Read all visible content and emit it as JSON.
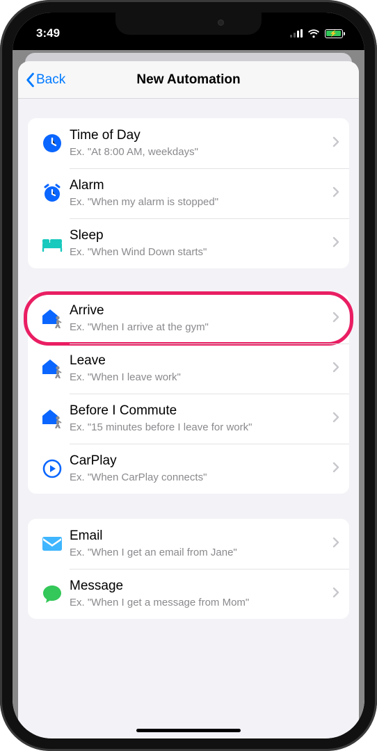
{
  "status": {
    "time": "3:49"
  },
  "nav": {
    "back_label": "Back",
    "title": "New Automation"
  },
  "groups": [
    {
      "rows": [
        {
          "icon": "clock-icon",
          "icon_color": "#0a66ff",
          "title": "Time of Day",
          "subtitle": "Ex. \"At 8:00 AM, weekdays\"",
          "highlight": false
        },
        {
          "icon": "alarm-icon",
          "icon_color": "#0a66ff",
          "title": "Alarm",
          "subtitle": "Ex. \"When my alarm is stopped\"",
          "highlight": false
        },
        {
          "icon": "bed-icon",
          "icon_color": "#18c9bd",
          "title": "Sleep",
          "subtitle": "Ex. \"When Wind Down starts\"",
          "highlight": false
        }
      ]
    },
    {
      "rows": [
        {
          "icon": "arrive-icon",
          "icon_color": "#0a66ff",
          "title": "Arrive",
          "subtitle": "Ex. \"When I arrive at the gym\"",
          "highlight": true
        },
        {
          "icon": "leave-icon",
          "icon_color": "#0a66ff",
          "title": "Leave",
          "subtitle": "Ex. \"When I leave work\"",
          "highlight": false
        },
        {
          "icon": "commute-icon",
          "icon_color": "#0a66ff",
          "title": "Before I Commute",
          "subtitle": "Ex. \"15 minutes before I leave for work\"",
          "highlight": false
        },
        {
          "icon": "carplay-icon",
          "icon_color": "#0a66ff",
          "title": "CarPlay",
          "subtitle": "Ex. \"When CarPlay connects\"",
          "highlight": false
        }
      ]
    },
    {
      "rows": [
        {
          "icon": "mail-icon",
          "icon_color": "#3fb6ff",
          "title": "Email",
          "subtitle": "Ex. \"When I get an email from Jane\"",
          "highlight": false
        },
        {
          "icon": "message-icon",
          "icon_color": "#34c759",
          "title": "Message",
          "subtitle": "Ex. \"When I get a message from Mom\"",
          "highlight": false
        }
      ]
    }
  ]
}
